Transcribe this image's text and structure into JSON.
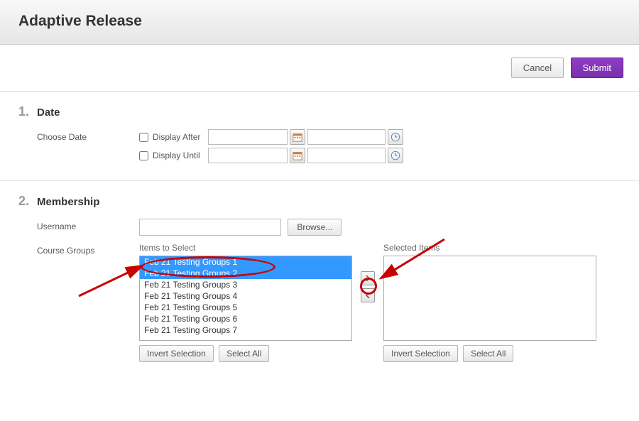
{
  "header": {
    "title": "Adaptive Release"
  },
  "actions": {
    "cancel": "Cancel",
    "submit": "Submit"
  },
  "sections": {
    "date": {
      "num": "1.",
      "title": "Date",
      "choose_label": "Choose Date",
      "display_after": "Display After",
      "display_until": "Display Until"
    },
    "membership": {
      "num": "2.",
      "title": "Membership",
      "username_label": "Username",
      "browse": "Browse...",
      "groups_label": "Course Groups",
      "items_to_select": "Items to Select",
      "selected_items": "Selected Items",
      "invert": "Invert Selection",
      "select_all": "Select All",
      "available": [
        {
          "label": "Feb 21 Testing Groups 1",
          "selected": true
        },
        {
          "label": "Feb 21 Testing Groups 2",
          "selected": true
        },
        {
          "label": "Feb 21 Testing Groups 3",
          "selected": false
        },
        {
          "label": "Feb 21 Testing Groups 4",
          "selected": false
        },
        {
          "label": "Feb 21 Testing Groups 5",
          "selected": false
        },
        {
          "label": "Feb 21 Testing Groups 6",
          "selected": false
        },
        {
          "label": "Feb 21 Testing Groups 7",
          "selected": false
        }
      ],
      "selected": []
    }
  },
  "colors": {
    "accent": "#7b2eb0",
    "annotation": "#c90000",
    "select_highlight": "#3399ff"
  }
}
